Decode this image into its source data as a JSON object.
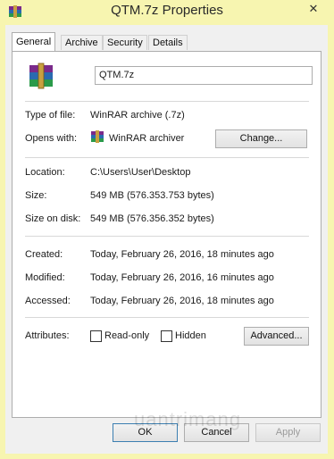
{
  "window": {
    "title": "QTM.7z Properties",
    "close_glyph": "✕",
    "icon": "winrar-icon"
  },
  "tabs": [
    {
      "label": "General",
      "active": true
    },
    {
      "label": "Archive",
      "active": false
    },
    {
      "label": "Security",
      "active": false
    },
    {
      "label": "Details",
      "active": false
    }
  ],
  "general": {
    "filename": "QTM.7z",
    "type_label": "Type of file:",
    "type_value": "WinRAR archive (.7z)",
    "opens_label": "Opens with:",
    "opens_value": "WinRAR archiver",
    "change_button": "Change...",
    "location_label": "Location:",
    "location_value": "C:\\Users\\User\\Desktop",
    "size_label": "Size:",
    "size_value": "549 MB (576.353.753 bytes)",
    "sizeondisk_label": "Size on disk:",
    "sizeondisk_value": "549 MB (576.356.352 bytes)",
    "created_label": "Created:",
    "created_value": "Today, February 26, 2016, 18 minutes ago",
    "modified_label": "Modified:",
    "modified_value": "Today, February 26, 2016, 16 minutes ago",
    "accessed_label": "Accessed:",
    "accessed_value": "Today, February 26, 2016, 18 minutes ago",
    "attributes_label": "Attributes:",
    "readonly_label": "Read-only",
    "hidden_label": "Hidden",
    "advanced_button": "Advanced..."
  },
  "footer": {
    "ok": "OK",
    "cancel": "Cancel",
    "apply": "Apply"
  },
  "watermark": "uantrimang",
  "colors": {
    "window_frame": "#f7f5b0",
    "dialog_bg": "#f0f0f0",
    "panel_bg": "#ffffff",
    "default_button_border": "#3c7fb1"
  }
}
